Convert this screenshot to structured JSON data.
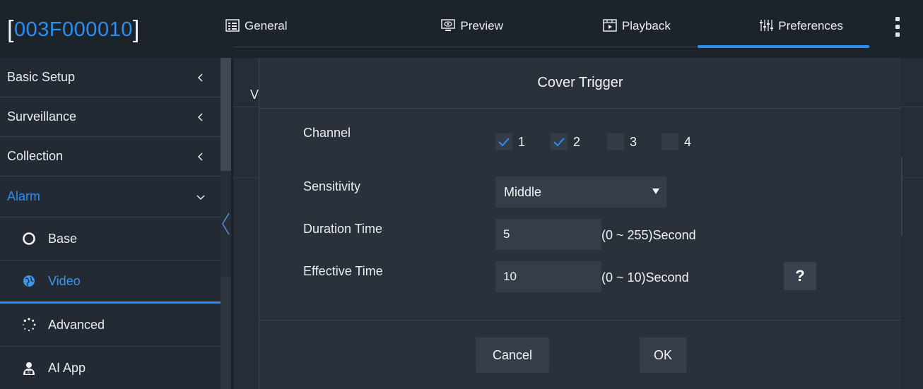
{
  "device": {
    "id": "003F000010",
    "open_bracket": "[",
    "close_bracket": "]"
  },
  "tabs": [
    {
      "label": "General",
      "icon": "list-window-icon",
      "active": false
    },
    {
      "label": "Preview",
      "icon": "monitor-eye-icon",
      "active": false
    },
    {
      "label": "Playback",
      "icon": "film-play-icon",
      "active": false
    },
    {
      "label": "Preferences",
      "icon": "sliders-icon",
      "active": true
    }
  ],
  "menu_icon": "more-vertical-icon",
  "sidebar": {
    "items": [
      {
        "label": "Basic Setup",
        "expanded": false
      },
      {
        "label": "Surveillance",
        "expanded": false
      },
      {
        "label": "Collection",
        "expanded": false
      },
      {
        "label": "Alarm",
        "expanded": true
      }
    ],
    "subitems": [
      {
        "label": "Base",
        "icon": "circle-outline-icon",
        "selected": false
      },
      {
        "label": "Video",
        "icon": "globe-icon",
        "selected": true
      },
      {
        "label": "Advanced",
        "icon": "dotted-circle-icon",
        "selected": false
      },
      {
        "label": "AI App",
        "icon": "person-ai-icon",
        "selected": false
      }
    ]
  },
  "background_peek": "V",
  "dialog": {
    "title": "Cover Trigger",
    "channel_label": "Channel",
    "channels": [
      {
        "label": "1",
        "checked": true
      },
      {
        "label": "2",
        "checked": true
      },
      {
        "label": "3",
        "checked": false
      },
      {
        "label": "4",
        "checked": false
      }
    ],
    "sensitivity_label": "Sensitivity",
    "sensitivity_value": "Middle",
    "duration_label": "Duration Time",
    "duration_value": "5",
    "duration_unit": "(0 ~ 255)Second",
    "effective_label": "Effective Time",
    "effective_value": "10",
    "effective_unit": "(0 ~ 10)Second",
    "help_label": "?",
    "cancel_label": "Cancel",
    "ok_label": "OK"
  },
  "colors": {
    "accent": "#2b8ff0",
    "background": "#1b2129",
    "panel": "#2a313b"
  }
}
